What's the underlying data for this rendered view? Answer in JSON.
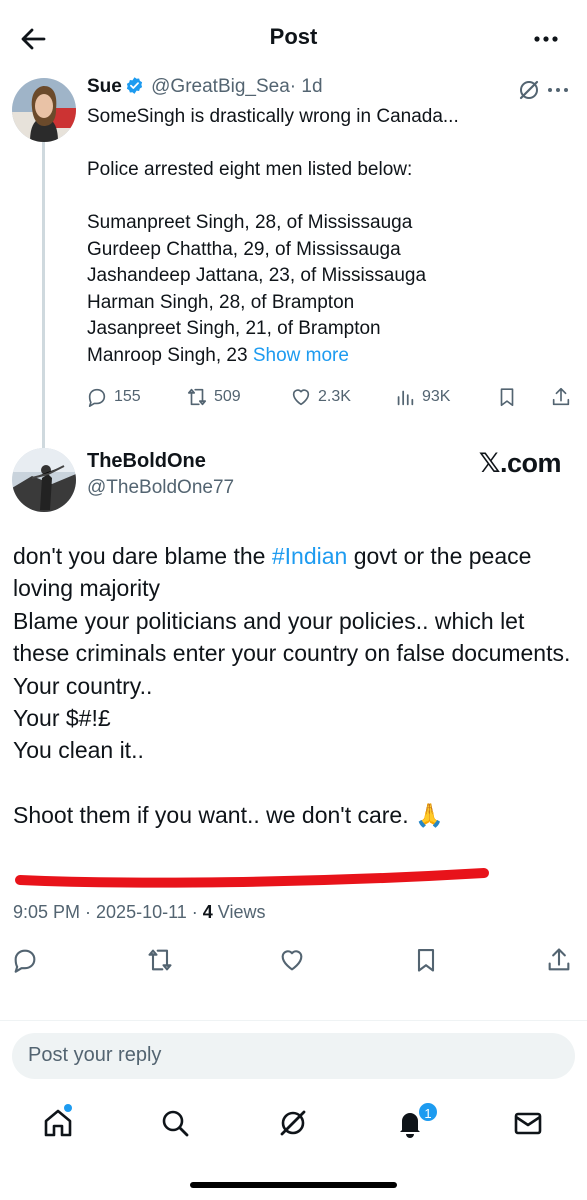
{
  "header": {
    "title": "Post"
  },
  "parent_post": {
    "name": "Sue",
    "handle": "@GreatBig_Sea",
    "time": "· 1d",
    "body": "SomeSingh is drastically wrong in Canada...\n\nPolice arrested eight men listed below:\n\nSumanpreet Singh, 28, of Mississauga\nGurdeep Chattha, 29, of Mississauga\nJashandeep Jattana, 23, of Mississauga\nHarman Singh, 28, of Brampton\nJasanpreet Singh, 21, of Brampton\nManroop Singh, 23 ",
    "show_more": "Show more",
    "replies": "155",
    "reposts": "509",
    "likes": "2.3K",
    "views": "93K"
  },
  "main_post": {
    "name": "TheBoldOne",
    "handle": "@TheBoldOne77",
    "watermark": "𝕏.com",
    "body_before": "don't you dare blame the ",
    "hashtag": "#Indian",
    "body_after": " govt or the peace loving majority\nBlame your politicians and your policies.. which let these criminals enter your country on false documents.\nYour country..\nYour $#!£\nYou clean it..\n\nShoot them if you want.. we don't care. 🙏",
    "timestamp": "9:05 PM · 2025-10-11 · ",
    "views_count": "4",
    "views_label": " Views",
    "annotation_color": "#e8131a"
  },
  "reply": {
    "placeholder": "Post your reply"
  },
  "tabbar": {
    "notifications_badge": "1"
  },
  "colors": {
    "accent": "#1d9bf0",
    "text": "#0f1419",
    "muted": "#536471"
  }
}
